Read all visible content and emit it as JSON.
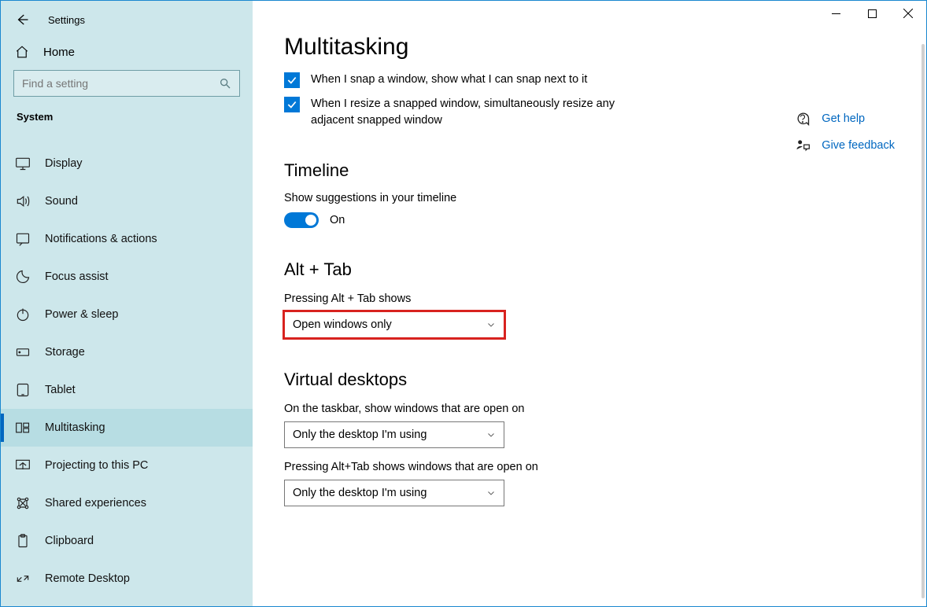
{
  "app_name": "Settings",
  "home_label": "Home",
  "search": {
    "placeholder": "Find a setting"
  },
  "category_label": "System",
  "nav": [
    {
      "key": "display",
      "label": "Display",
      "icon": "monitor"
    },
    {
      "key": "sound",
      "label": "Sound",
      "icon": "sound"
    },
    {
      "key": "notifications",
      "label": "Notifications & actions",
      "icon": "notification"
    },
    {
      "key": "focus",
      "label": "Focus assist",
      "icon": "moon"
    },
    {
      "key": "power",
      "label": "Power & sleep",
      "icon": "power"
    },
    {
      "key": "storage",
      "label": "Storage",
      "icon": "storage"
    },
    {
      "key": "tablet",
      "label": "Tablet",
      "icon": "tablet"
    },
    {
      "key": "multitasking",
      "label": "Multitasking",
      "icon": "multitask",
      "active": true
    },
    {
      "key": "projecting",
      "label": "Projecting to this PC",
      "icon": "project"
    },
    {
      "key": "shared",
      "label": "Shared experiences",
      "icon": "share"
    },
    {
      "key": "clipboard",
      "label": "Clipboard",
      "icon": "clipboard"
    },
    {
      "key": "remote",
      "label": "Remote Desktop",
      "icon": "remote"
    }
  ],
  "page_title": "Multitasking",
  "snap": {
    "check1": "When I snap a window, show what I can snap next to it",
    "check2": "When I resize a snapped window, simultaneously resize any adjacent snapped window"
  },
  "timeline": {
    "heading": "Timeline",
    "label": "Show suggestions in your timeline",
    "state": "On"
  },
  "alttab": {
    "heading": "Alt + Tab",
    "label": "Pressing Alt + Tab shows",
    "value": "Open windows only"
  },
  "virtual": {
    "heading": "Virtual desktops",
    "taskbar_label": "On the taskbar, show windows that are open on",
    "taskbar_value": "Only the desktop I'm using",
    "alttab_label": "Pressing Alt+Tab shows windows that are open on",
    "alttab_value": "Only the desktop I'm using"
  },
  "help": {
    "get_help": "Get help",
    "feedback": "Give feedback"
  }
}
